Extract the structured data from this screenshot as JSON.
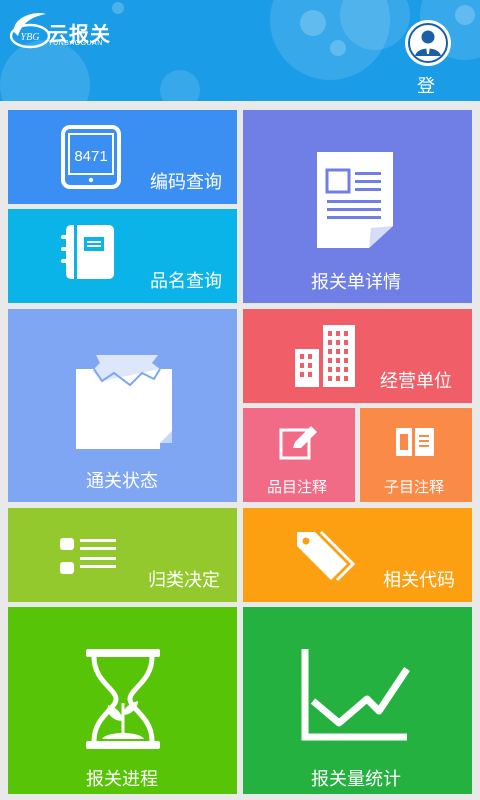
{
  "app": {
    "title": "云报关",
    "subtitle": "YUNBAOGUAN",
    "logo_mark": "YBG",
    "login_label": "登 录"
  },
  "colors": {
    "header": "#1a9ce6",
    "code_query": "#3b8ff2",
    "name_query": "#0ab4e8",
    "declaration_detail": "#6f7fe6",
    "clearance_status": "#7fa6f2",
    "business_unit": "#f05f67",
    "item_notes": "#f26b86",
    "subitem_notes": "#fa8a48",
    "classification": "#93c92c",
    "related_codes": "#fca012",
    "progress": "#58c407",
    "statistics": "#25b140"
  },
  "tiles": {
    "code_query": {
      "label": "编码查询",
      "icon": "tablet-icon",
      "icon_text": "8471"
    },
    "name_query": {
      "label": "品名查询",
      "icon": "notebook-icon"
    },
    "declaration_detail": {
      "label": "报关单详情",
      "icon": "document-icon"
    },
    "clearance_status": {
      "label": "通关状态",
      "icon": "open-box-icon"
    },
    "business_unit": {
      "label": "经营单位",
      "icon": "buildings-icon"
    },
    "item_notes": {
      "label": "品目注释",
      "icon": "edit-icon"
    },
    "subitem_notes": {
      "label": "子目注释",
      "icon": "book-icon"
    },
    "classification": {
      "label": "归类决定",
      "icon": "list-icon"
    },
    "related_codes": {
      "label": "相关代码",
      "icon": "tags-icon"
    },
    "progress": {
      "label": "报关进程",
      "icon": "hourglass-icon"
    },
    "statistics": {
      "label": "报关量统计",
      "icon": "line-chart-icon"
    }
  }
}
